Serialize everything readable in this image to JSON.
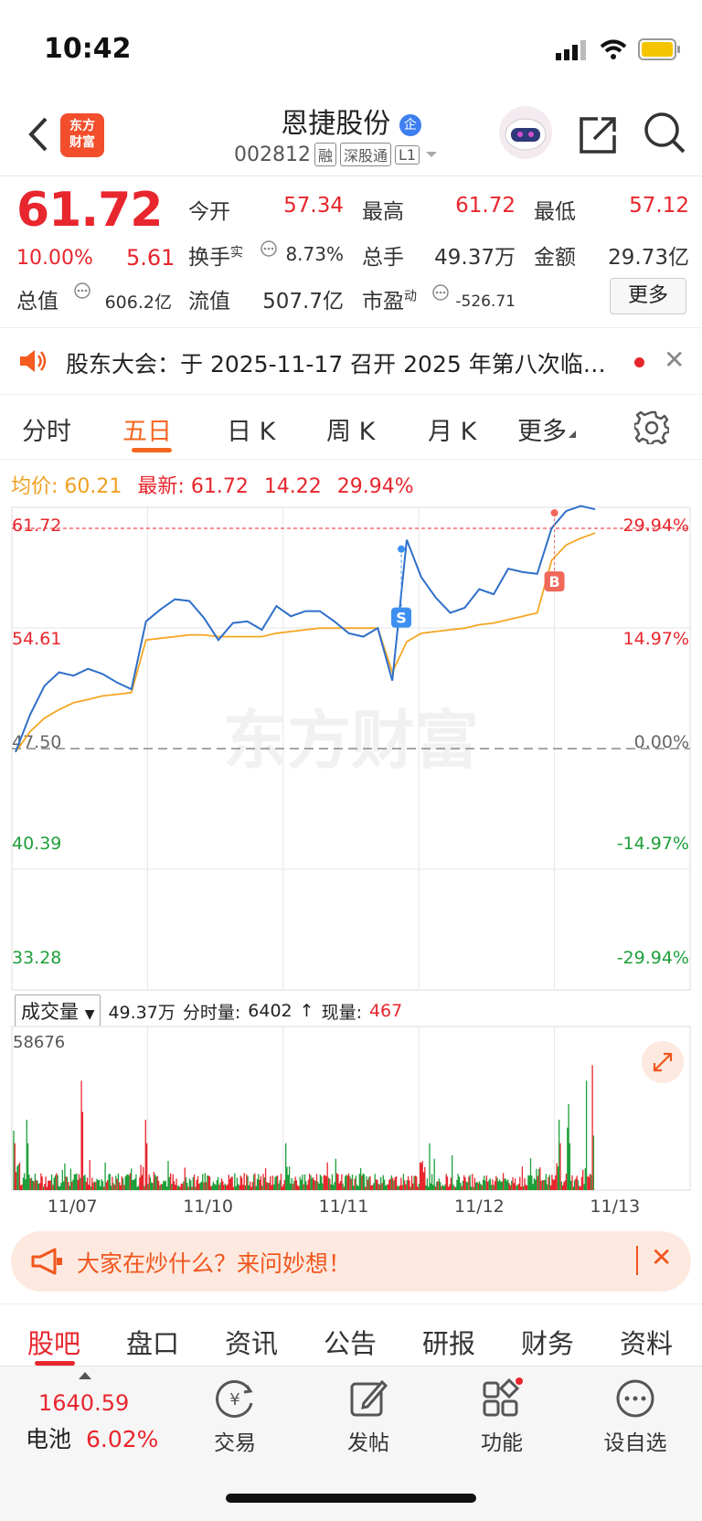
{
  "status": {
    "time": "10:42"
  },
  "header": {
    "logo_text_line1": "东方",
    "logo_text_line2": "财富",
    "stock_name": "恩捷股份",
    "stock_code": "002812",
    "tags": [
      "融",
      "深股通",
      "L1"
    ],
    "ent_badge": "企"
  },
  "quote": {
    "price": "61.72",
    "pct": "10.00%",
    "change": "5.61",
    "open_label": "今开",
    "open": "57.34",
    "high_label": "最高",
    "high": "61.72",
    "low_label": "最低",
    "low": "57.12",
    "turnover_label": "换手",
    "turnover_sup": "实",
    "turnover": "8.73%",
    "volume_label": "总手",
    "volume": "49.37万",
    "amount_label": "金额",
    "amount": "29.73亿",
    "mktcap_label": "总值",
    "mktcap": "606.2亿",
    "float_label": "流值",
    "float": "507.7亿",
    "pe_label": "市盈",
    "pe_sup": "动",
    "pe": "-526.71",
    "more_label": "更多"
  },
  "notice": {
    "text": "股东大会：于 2025-11-17 召开 2025 年第八次临…"
  },
  "tabs": [
    "分时",
    "五日",
    "日 K",
    "周 K",
    "月 K",
    "更多"
  ],
  "active_tab": "五日",
  "chart_info": {
    "avg_label": "均价:",
    "avg": "60.21",
    "latest_label": "最新:",
    "latest": "61.72",
    "latest_chg": "14.22",
    "latest_pct": "29.94%"
  },
  "chart_data": {
    "type": "line",
    "watermark": "东方财富",
    "y_ticks_left": [
      "61.72",
      "54.61",
      "47.50",
      "40.39",
      "33.28"
    ],
    "y_ticks_right": [
      "29.94%",
      "14.97%",
      "0.00%",
      "-14.97%",
      "-29.94%"
    ],
    "ylim": [
      33.28,
      61.72
    ],
    "base": 47.5,
    "days": [
      "11/07",
      "11/10",
      "11/11",
      "11/12",
      "11/13"
    ],
    "series": [
      {
        "name": "price",
        "color": "#2f6fc9",
        "values": [
          47.3,
          49.5,
          51.2,
          52.0,
          51.8,
          52.2,
          51.9,
          51.4,
          51.0,
          55.0,
          55.7,
          56.3,
          56.2,
          55.2,
          53.9,
          54.9,
          55.0,
          54.5,
          55.9,
          55.3,
          55.6,
          55.6,
          55.0,
          54.3,
          54.1,
          54.6,
          51.5,
          59.8,
          57.6,
          56.4,
          55.5,
          55.8,
          56.9,
          56.6,
          58.1,
          57.9,
          57.8,
          60.5,
          61.5,
          61.8,
          61.6
        ]
      },
      {
        "name": "avg",
        "color": "#f5a623",
        "values": [
          47.3,
          48.5,
          49.3,
          49.8,
          50.2,
          50.4,
          50.6,
          50.7,
          50.8,
          53.9,
          54.0,
          54.1,
          54.2,
          54.2,
          54.1,
          54.1,
          54.1,
          54.1,
          54.3,
          54.4,
          54.5,
          54.6,
          54.6,
          54.6,
          54.6,
          54.6,
          52.0,
          53.8,
          54.3,
          54.4,
          54.5,
          54.6,
          54.8,
          54.9,
          55.1,
          55.3,
          55.5,
          58.6,
          59.5,
          59.9,
          60.2
        ]
      }
    ],
    "markers": [
      {
        "label": "S",
        "color": "#3d8ff0"
      },
      {
        "label": "B",
        "color": "#f0685a"
      }
    ],
    "volume": {
      "label": "成交量",
      "total": "49.37万",
      "tick_label": "分时量:",
      "tick_value": "6402",
      "now_label": "现量:",
      "now_value": "467",
      "max_label": "58676"
    }
  },
  "ad": {
    "text": "大家在炒什么？来问妙想！"
  },
  "sub_tabs": [
    "股吧",
    "盘口",
    "资讯",
    "公告",
    "研报",
    "财务",
    "资料"
  ],
  "toolbar": {
    "battery_value": "1640.59",
    "battery_label": "电池",
    "battery_pct": "6.02%",
    "trade": "交易",
    "post": "发帖",
    "func": "功能",
    "watch": "设自选"
  }
}
